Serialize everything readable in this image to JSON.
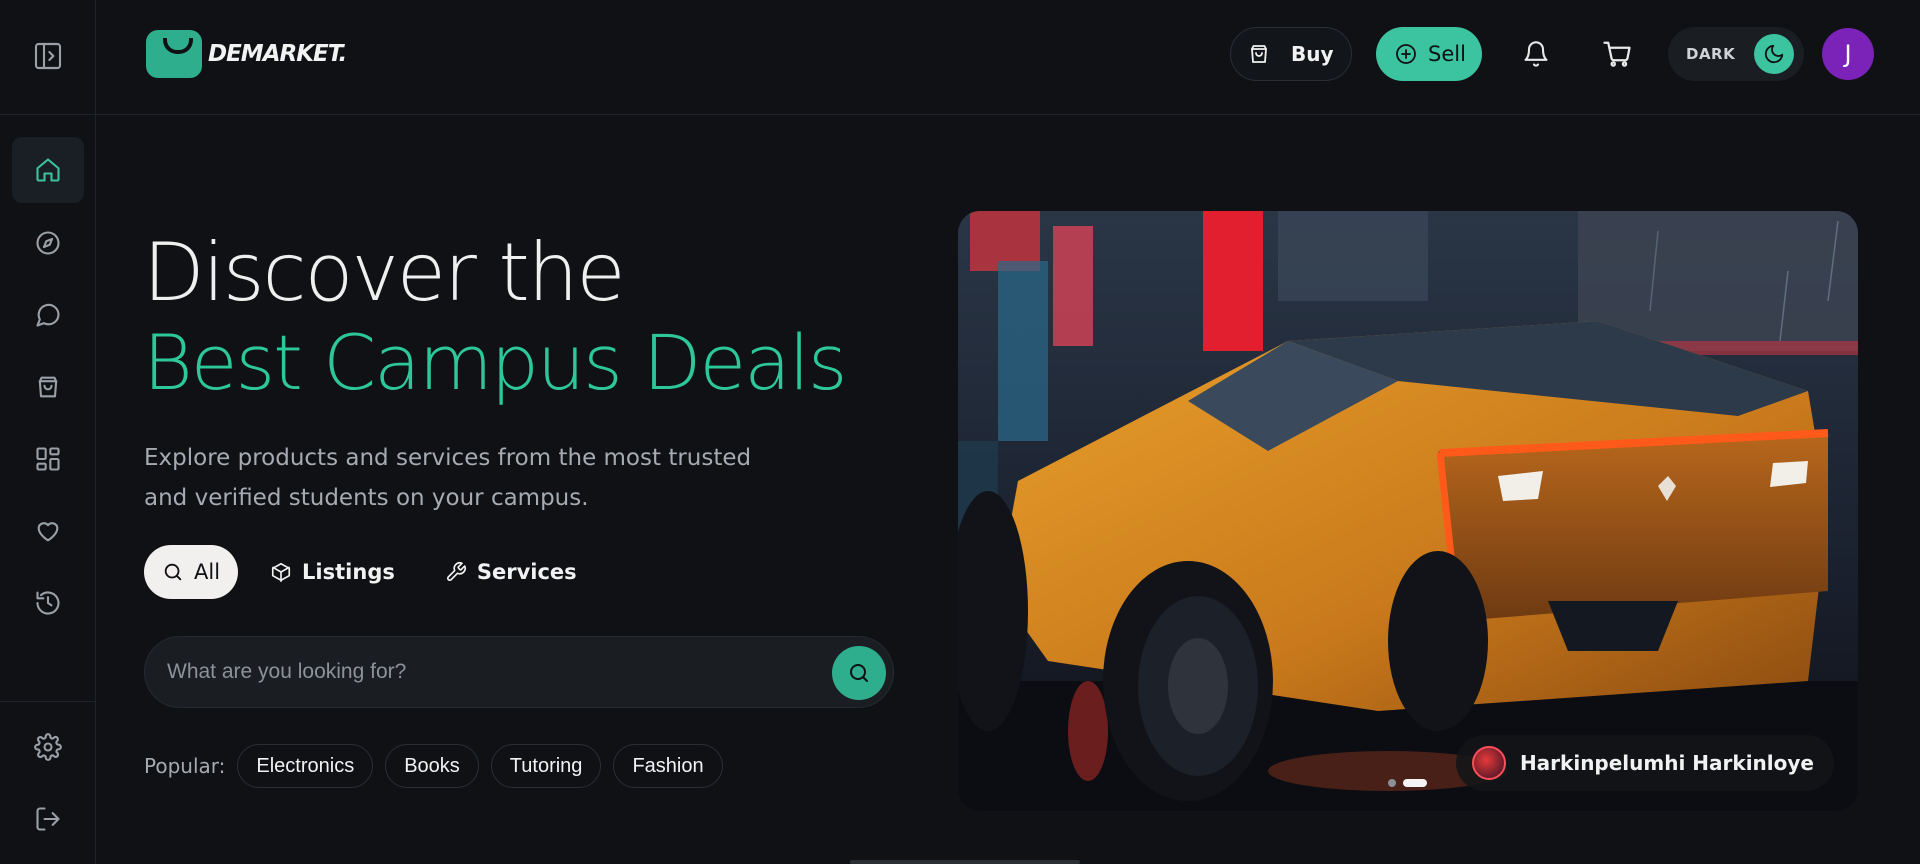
{
  "brand": {
    "name": "DEMARKET."
  },
  "header": {
    "buy_label": "Buy",
    "sell_label": "Sell",
    "theme_label": "DARK",
    "avatar_initial": "J"
  },
  "sidebar": {
    "items": [
      {
        "name": "home",
        "icon": "home-icon",
        "active": true
      },
      {
        "name": "explore",
        "icon": "compass-icon",
        "active": false
      },
      {
        "name": "messages",
        "icon": "chat-icon",
        "active": false
      },
      {
        "name": "orders",
        "icon": "shopping-bag-icon",
        "active": false
      },
      {
        "name": "dashboard",
        "icon": "grid-icon",
        "active": false
      },
      {
        "name": "favorites",
        "icon": "heart-icon",
        "active": false
      },
      {
        "name": "history",
        "icon": "history-icon",
        "active": false
      }
    ],
    "bottom": [
      {
        "name": "settings",
        "icon": "gear-icon"
      },
      {
        "name": "logout",
        "icon": "logout-icon"
      }
    ]
  },
  "hero": {
    "title_line1": "Discover the",
    "title_line2": "Best Campus Deals",
    "description": "Explore products and services from the most trusted and verified students on your campus."
  },
  "tabs": [
    {
      "label": "All",
      "icon": "search-icon",
      "active": true
    },
    {
      "label": "Listings",
      "icon": "box-icon",
      "active": false
    },
    {
      "label": "Services",
      "icon": "wrench-icon",
      "active": false
    }
  ],
  "search": {
    "placeholder": "What are you looking for?"
  },
  "popular": {
    "label": "Popular:",
    "chips": [
      "Electronics",
      "Books",
      "Tutoring",
      "Fashion"
    ]
  },
  "carousel": {
    "author_name": "Harkinpelumhi Harkinloye",
    "slide_count": 2,
    "active_slide": 2
  },
  "colors": {
    "accent": "#3cc3a0",
    "background": "#0f1115",
    "avatar": "#7b22b8"
  }
}
